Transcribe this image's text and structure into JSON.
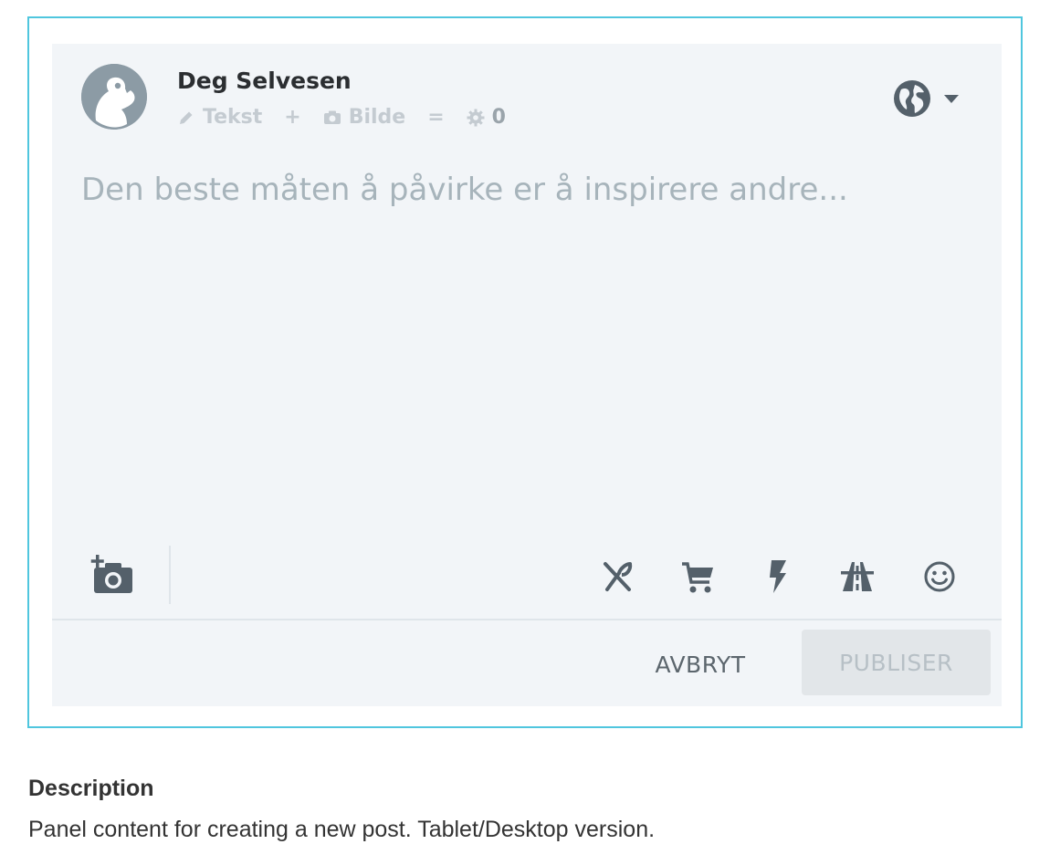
{
  "composer": {
    "user": {
      "name": "Deg Selvesen"
    },
    "meta": {
      "text_label": "Tekst",
      "plus_symbol": "+",
      "image_label": "Bilde",
      "equals_symbol": "=",
      "points": "0"
    },
    "placeholder": "Den beste måten å påvirke er å inspirere andre...",
    "icons": {
      "visibility": "globe-icon",
      "dropdown": "caret-down-icon",
      "add_photo": "add-camera-icon",
      "categories": [
        "fork-knife-icon",
        "shopping-cart-icon",
        "lightning-icon",
        "road-icon",
        "smiley-icon"
      ]
    },
    "actions": {
      "cancel": "AVBRYT",
      "publish": "PUBLISER"
    }
  },
  "description": {
    "title": "Description",
    "text": "Panel content for creating a new post. Tablet/Desktop version."
  },
  "colors": {
    "frame_border": "#4fc6de",
    "panel_bg": "#f2f5f8",
    "icon": "#54606a",
    "muted": "#c4cbd1"
  }
}
